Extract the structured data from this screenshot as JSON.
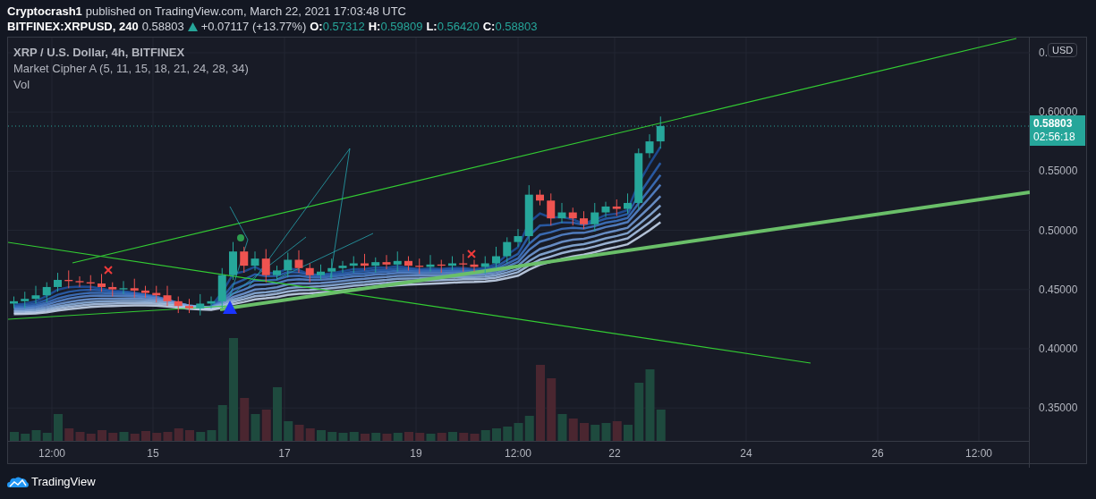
{
  "header": {
    "author": "Cryptocrash1",
    "published": "published on TradingView.com, March 22, 2021 17:03:48 UTC"
  },
  "symbol_bar": {
    "symbol": "BITFINEX:XRPUSD, 240",
    "last": "0.58803",
    "change": "+0.07117 (+13.77%)",
    "ohlc": [
      {
        "label": "O:",
        "value": "0.57312"
      },
      {
        "label": "H:",
        "value": "0.59809"
      },
      {
        "label": "L:",
        "value": "0.56420"
      },
      {
        "label": "C:",
        "value": "0.58803"
      }
    ]
  },
  "legend": {
    "title": "XRP / U.S. Dollar, 4h, BITFINEX",
    "indicator": "Market Cipher A (5, 11, 15, 18, 21, 24, 28, 34)",
    "volume": "Vol"
  },
  "price_axis": {
    "currency": "USD",
    "ticks": [
      "0.",
      "0.60000",
      "0.55000",
      "0.50000",
      "0.45000",
      "0.40000",
      "0.35000"
    ],
    "last_price": "0.58803",
    "countdown": "02:56:18"
  },
  "time_axis": {
    "ticks": [
      "12:00",
      "15",
      "17",
      "19",
      "12:00",
      "22",
      "24",
      "26",
      "12:00"
    ]
  },
  "footer": {
    "brand": "TradingView"
  }
}
